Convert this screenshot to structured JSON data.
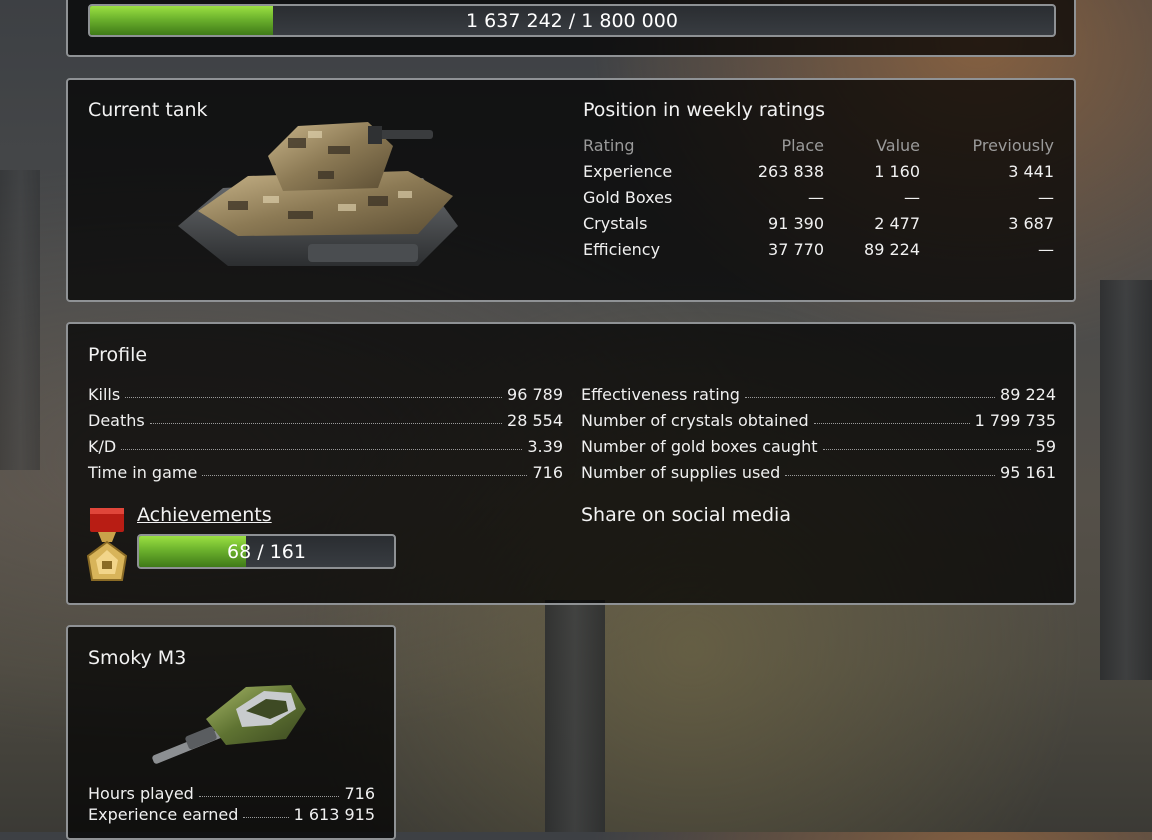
{
  "experience_bar": {
    "text": "1 637 242 / 1 800 000",
    "current": 1637242,
    "max": 1800000,
    "fill_fraction": 0.19
  },
  "current_tank": {
    "title": "Current tank"
  },
  "weekly_ratings": {
    "title": "Position in weekly ratings",
    "headers": [
      "Rating",
      "Place",
      "Value",
      "Previously"
    ],
    "rows": [
      [
        "Experience",
        "263 838",
        "1 160",
        "3 441"
      ],
      [
        "Gold Boxes",
        "—",
        "—",
        "—"
      ],
      [
        "Crystals",
        "91 390",
        "2 477",
        "3 687"
      ],
      [
        "Efficiency",
        "37 770",
        "89 224",
        "—"
      ]
    ]
  },
  "profile": {
    "title": "Profile",
    "left_stats": [
      {
        "label": "Kills",
        "value": "96 789"
      },
      {
        "label": "Deaths",
        "value": "28 554"
      },
      {
        "label": "K/D",
        "value": "3.39"
      },
      {
        "label": "Time in game",
        "value": "716"
      }
    ],
    "right_stats": [
      {
        "label": "Effectiveness rating",
        "value": "89 224"
      },
      {
        "label": "Number of crystals obtained",
        "value": "1 799 735"
      },
      {
        "label": "Number of gold boxes caught",
        "value": "59"
      },
      {
        "label": "Number of supplies used",
        "value": "95 161"
      }
    ],
    "achievements": {
      "label": "Achievements",
      "progress_text": "68 / 161",
      "current": 68,
      "max": 161,
      "fill_fraction": 0.42
    },
    "share_label": "Share on social media"
  },
  "turret": {
    "title": "Smoky M3",
    "stats": [
      {
        "label": "Hours played",
        "value": "716"
      },
      {
        "label": "Experience earned",
        "value": "1 613 915"
      }
    ]
  },
  "colors": {
    "bar_fill": "#6cb22d",
    "panel_border": "#8f9295",
    "header_text": "#9a9a9a"
  }
}
